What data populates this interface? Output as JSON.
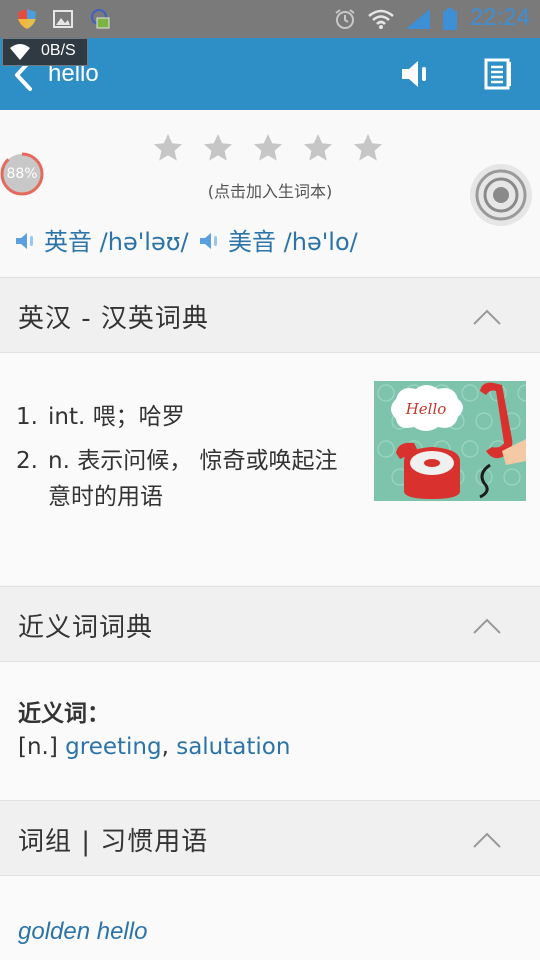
{
  "status_bar": {
    "time": "22:24",
    "left_icons": [
      "shield-icon",
      "image-icon",
      "android-icon"
    ],
    "right_icons": [
      "alarm-icon",
      "wifi-icon",
      "signal-icon",
      "battery-icon"
    ],
    "net_speed": "0B/S"
  },
  "app_bar": {
    "title": "hello",
    "accent": "#2e8fc6",
    "actions": [
      "speaker-icon",
      "notebook-icon"
    ]
  },
  "word": {
    "rating_total": 5,
    "rating_filled": 0,
    "add_hint": "(点击加入生词本)",
    "progress_label": "88%",
    "progress": 0.88,
    "uk_label": "英音",
    "uk_ipa": "/hə'ləʊ/",
    "us_label": "美音",
    "us_ipa": "/hə'lo/"
  },
  "sections": {
    "dict": {
      "title": "英汉 - 汉英词典",
      "definitions": [
        {
          "num": "1.",
          "text": "int. 喂；哈罗"
        },
        {
          "num": "2.",
          "text": "n. 表示问候， 惊奇或唤起注意时的用语"
        }
      ],
      "image_text": "Hello"
    },
    "synonyms": {
      "title": "近义词词典",
      "label": "近义词：",
      "pos": "[n.]",
      "words": [
        "greeting",
        "salutation"
      ],
      "separator": ","
    },
    "phrases": {
      "title": "词组 | 习惯用语",
      "items": [
        "golden hello"
      ]
    }
  }
}
